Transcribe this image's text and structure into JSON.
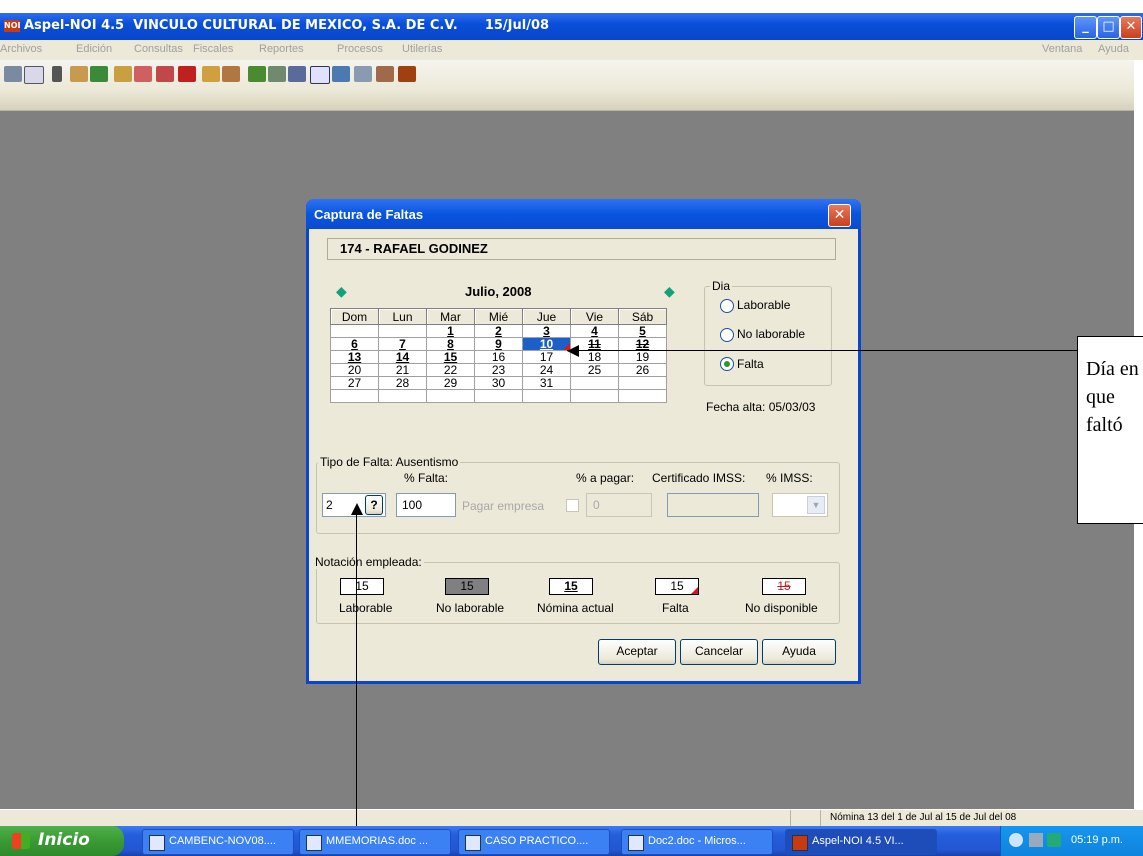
{
  "window": {
    "title": "Aspel-NOI 4.5  VINCULO CULTURAL DE MEXICO, S.A. DE C.V.      15/Jul/08",
    "app_icon": "NOI"
  },
  "menu": {
    "left": [
      "Archivos",
      "Edición",
      "Consultas",
      "Fiscales",
      "Reportes",
      "Procesos",
      "Utilerías"
    ],
    "right": [
      "Ventana",
      "Ayuda"
    ]
  },
  "status": {
    "nomina": "Nómina 13 del 1 de Jul al 15 de Jul del 08"
  },
  "taskbar": {
    "start_label": "Inicio",
    "tasks": [
      "CAMBENC-NOV08....",
      "MMEMORIAS.doc ...",
      "CASO PRACTICO....",
      "Doc2.doc - Micros...",
      "Aspel-NOI 4.5  VI..."
    ],
    "clock": "05:19 p.m."
  },
  "dialog": {
    "title": "Captura de Faltas",
    "employee": "174 - RAFAEL  GODINEZ",
    "calendar": {
      "month_label": "Julio, 2008",
      "headers": [
        "Dom",
        "Lun",
        "Mar",
        "Mié",
        "Jue",
        "Vie",
        "Sáb"
      ],
      "weeks": [
        [
          "",
          "",
          "1",
          "2",
          "3",
          "4",
          "5"
        ],
        [
          "6",
          "7",
          "8",
          "9",
          "10",
          "11",
          "12"
        ],
        [
          "13",
          "14",
          "15",
          "16",
          "17",
          "18",
          "19"
        ],
        [
          "20",
          "21",
          "22",
          "23",
          "24",
          "25",
          "26"
        ],
        [
          "27",
          "28",
          "29",
          "30",
          "31",
          "",
          ""
        ],
        [
          "",
          "",
          "",
          "",
          "",
          "",
          ""
        ]
      ]
    },
    "dia": {
      "legend": "Dia",
      "options": [
        "Laborable",
        "No laborable",
        "Falta"
      ],
      "selected": "Falta"
    },
    "fecha_alta": "Fecha alta: 05/03/03",
    "tipo": {
      "legend": "Tipo de Falta: Ausentismo",
      "pct_falta_label": "% Falta:",
      "pct_pagar_label": "% a  pagar:",
      "cert_label": "Certificado IMSS:",
      "pct_imss_label": "% IMSS:",
      "code": "2",
      "help": "?",
      "pct_falta": "100",
      "pagar_empresa": "Pagar empresa",
      "pct_pagar": "0"
    },
    "notacion": {
      "legend": "Notación empleada:",
      "sample": "15",
      "labels": [
        "Laborable",
        "No laborable",
        "Nómina actual",
        "Falta",
        "No disponible"
      ]
    },
    "buttons": {
      "accept": "Aceptar",
      "cancel": "Cancelar",
      "help": "Ayuda"
    }
  },
  "callout": {
    "text": "Día en que faltó"
  }
}
